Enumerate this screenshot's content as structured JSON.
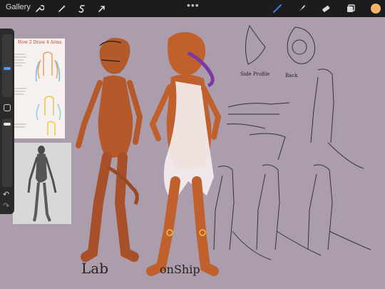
{
  "app": {
    "gallery_label": "Gallery"
  },
  "toolbar": {
    "left_tools": [
      "wrench-icon",
      "magic-wand-icon",
      "selection-s-icon",
      "move-arrow-icon"
    ],
    "right_tools": [
      "brush-icon",
      "smudge-icon",
      "eraser-icon",
      "layers-icon"
    ],
    "more_label": "•••",
    "color_swatch": "#f5b26b",
    "brush_color": "#3d7bd9"
  },
  "sidebar": {
    "undo_label": "↶"
  },
  "reference": {
    "sheet_title": "How 2 Draw 4 Arms"
  },
  "canvas": {
    "background": "#ab9dab",
    "annotations": {
      "lab": "Lab",
      "onship": "onShip",
      "side_profile": "Side Profile",
      "back": "Back"
    }
  }
}
